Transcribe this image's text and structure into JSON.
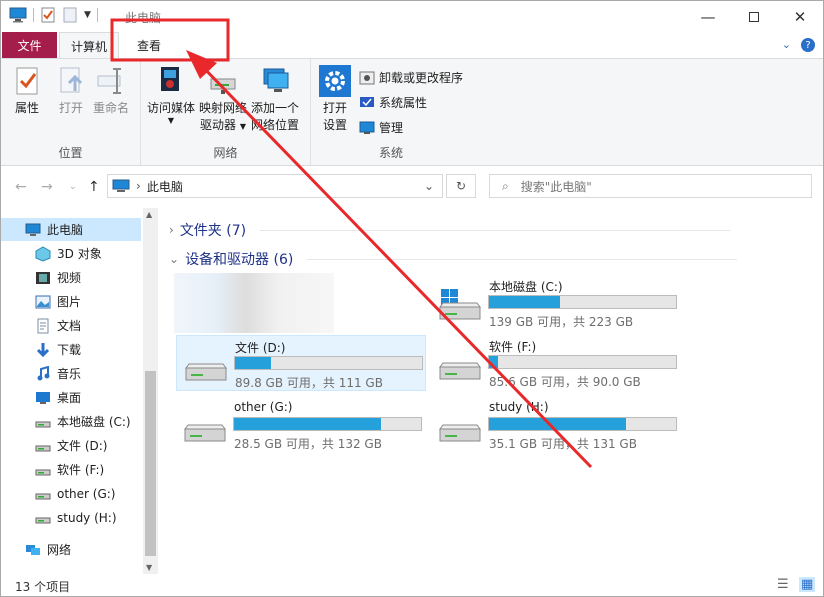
{
  "window": {
    "title": "此电脑",
    "controls": [
      "minimize-icon",
      "maximize-icon",
      "close-icon"
    ]
  },
  "tabs": [
    {
      "label": "文件"
    },
    {
      "label": "计算机"
    },
    {
      "label": "查看"
    }
  ],
  "ribbon": {
    "groups": [
      {
        "label": "位置",
        "buttons": [
          "属性",
          "打开",
          "重命名"
        ]
      },
      {
        "label": "网络",
        "buttons": [
          {
            "line1": "访问媒体"
          },
          {
            "line1": "映射网络",
            "line2": "驱动器"
          },
          {
            "line1": "添加一个",
            "line2": "网络位置"
          }
        ]
      },
      {
        "label": "系统",
        "big": {
          "line1": "打开",
          "line2": "设置"
        },
        "small": [
          "卸载或更改程序",
          "系统属性",
          "管理"
        ]
      }
    ]
  },
  "address": {
    "path": "此电脑",
    "search_placeholder": "搜索\"此电脑\""
  },
  "nav": {
    "items": [
      {
        "label": "此电脑",
        "icon": "computer-icon"
      },
      {
        "label": "3D 对象",
        "icon": "cube-icon"
      },
      {
        "label": "视频",
        "icon": "video-icon"
      },
      {
        "label": "图片",
        "icon": "picture-icon"
      },
      {
        "label": "文档",
        "icon": "document-icon"
      },
      {
        "label": "下载",
        "icon": "download-icon"
      },
      {
        "label": "音乐",
        "icon": "music-icon"
      },
      {
        "label": "桌面",
        "icon": "desktop-icon"
      },
      {
        "label": "本地磁盘 (C:)",
        "icon": "drive-icon"
      },
      {
        "label": "文件 (D:)",
        "icon": "drive-icon"
      },
      {
        "label": "软件 (F:)",
        "icon": "drive-icon"
      },
      {
        "label": "other (G:)",
        "icon": "drive-icon"
      },
      {
        "label": "study (H:)",
        "icon": "drive-icon"
      },
      {
        "label": "网络",
        "icon": "network-icon"
      }
    ]
  },
  "content": {
    "folders_header": "文件夹 (7)",
    "devices_header": "设备和驱动器 (6)",
    "drives": [
      {
        "name": "本地磁盘 (C:)",
        "free": "139 GB 可用，共 223 GB",
        "used_fraction": 0.377
      },
      {
        "name": "文件 (D:)",
        "free": "89.8 GB 可用，共 111 GB",
        "used_fraction": 0.191
      },
      {
        "name": "软件 (F:)",
        "free": "85.6 GB 可用，共 90.0 GB",
        "used_fraction": 0.049
      },
      {
        "name": "other (G:)",
        "free": "28.5 GB 可用，共 132 GB",
        "used_fraction": 0.784
      },
      {
        "name": "study (H:)",
        "free": "35.1 GB 可用，共 131 GB",
        "used_fraction": 0.732
      }
    ]
  },
  "status": {
    "count": "13 个项目"
  },
  "colors": {
    "file_tab": "#a51e4b",
    "drive_fill": "#26a0da",
    "annotation": "#e8282b"
  }
}
